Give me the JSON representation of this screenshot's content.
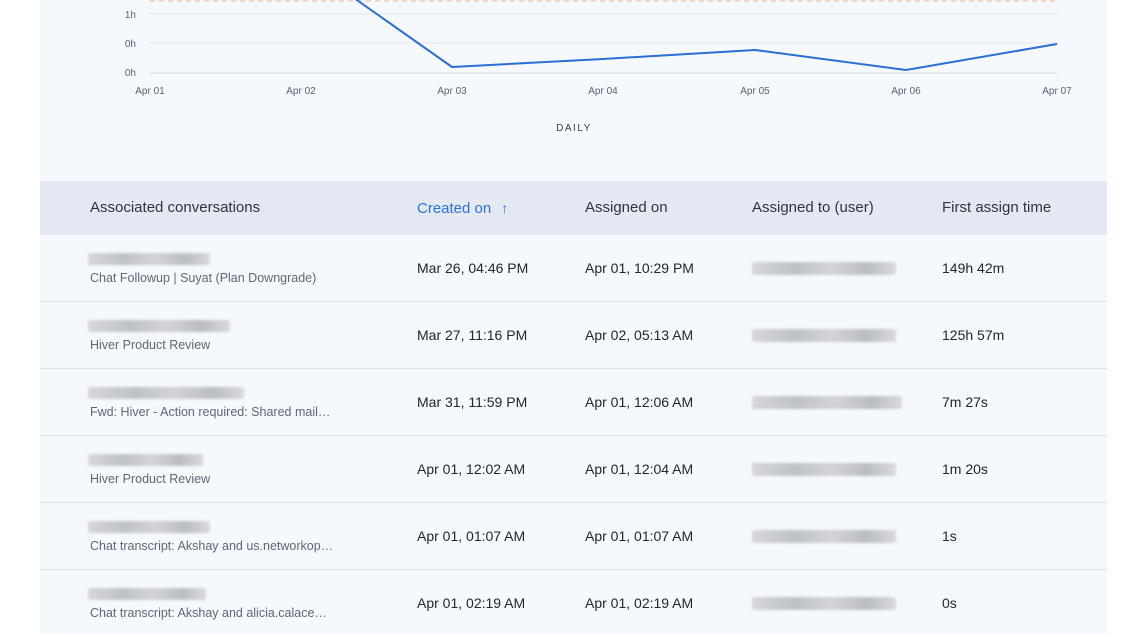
{
  "chart": {
    "y_ticks": [
      "1h",
      "0h",
      "0h"
    ],
    "x_ticks": [
      "Apr 01",
      "Apr 02",
      "Apr 03",
      "Apr 04",
      "Apr 05",
      "Apr 06",
      "Apr 07"
    ],
    "xlabel": "DAILY",
    "line_color": "#2a6fd6",
    "target_line_color": "#f2b38a"
  },
  "chart_data": {
    "type": "line",
    "x": [
      "Apr 01",
      "Apr 02",
      "Apr 03",
      "Apr 04",
      "Apr 05",
      "Apr 06",
      "Apr 07"
    ],
    "series": [
      {
        "values_hours": [
          null,
          1.5,
          0.2,
          0.3,
          0.35,
          0.1,
          0.6
        ]
      }
    ],
    "xlabel": "DAILY",
    "grid": true
  },
  "table": {
    "headers": {
      "conversation": "Associated conversations",
      "created": "Created on",
      "created_sort_icon": "↑",
      "assigned_on": "Assigned on",
      "assigned_to": "Assigned to (user)",
      "first_assign": "First assign time"
    },
    "rows": [
      {
        "subject": "Chat Followup | Suyat (Plan Downgrade)",
        "created": "Mar 26, 04:46 PM",
        "assigned_on": "Apr 01, 10:29 PM",
        "first_assign": "149h 42m"
      },
      {
        "subject": "Hiver Product Review",
        "created": "Mar 27, 11:16 PM",
        "assigned_on": "Apr 02, 05:13 AM",
        "first_assign": "125h 57m"
      },
      {
        "subject": "Fwd: Hiver - Action required: Shared mail…",
        "created": "Mar 31, 11:59 PM",
        "assigned_on": "Apr 01, 12:06 AM",
        "first_assign": "7m 27s"
      },
      {
        "subject": "Hiver Product Review",
        "created": "Apr 01, 12:02 AM",
        "assigned_on": "Apr 01, 12:04 AM",
        "first_assign": "1m 20s"
      },
      {
        "subject": "Chat transcript: Akshay and us.networkop…",
        "created": "Apr 01, 01:07 AM",
        "assigned_on": "Apr 01, 01:07 AM",
        "first_assign": "1s"
      },
      {
        "subject": "Chat transcript: Akshay and alicia.calace…",
        "created": "Apr 01, 02:19 AM",
        "assigned_on": "Apr 01, 02:19 AM",
        "first_assign": "0s"
      }
    ]
  }
}
